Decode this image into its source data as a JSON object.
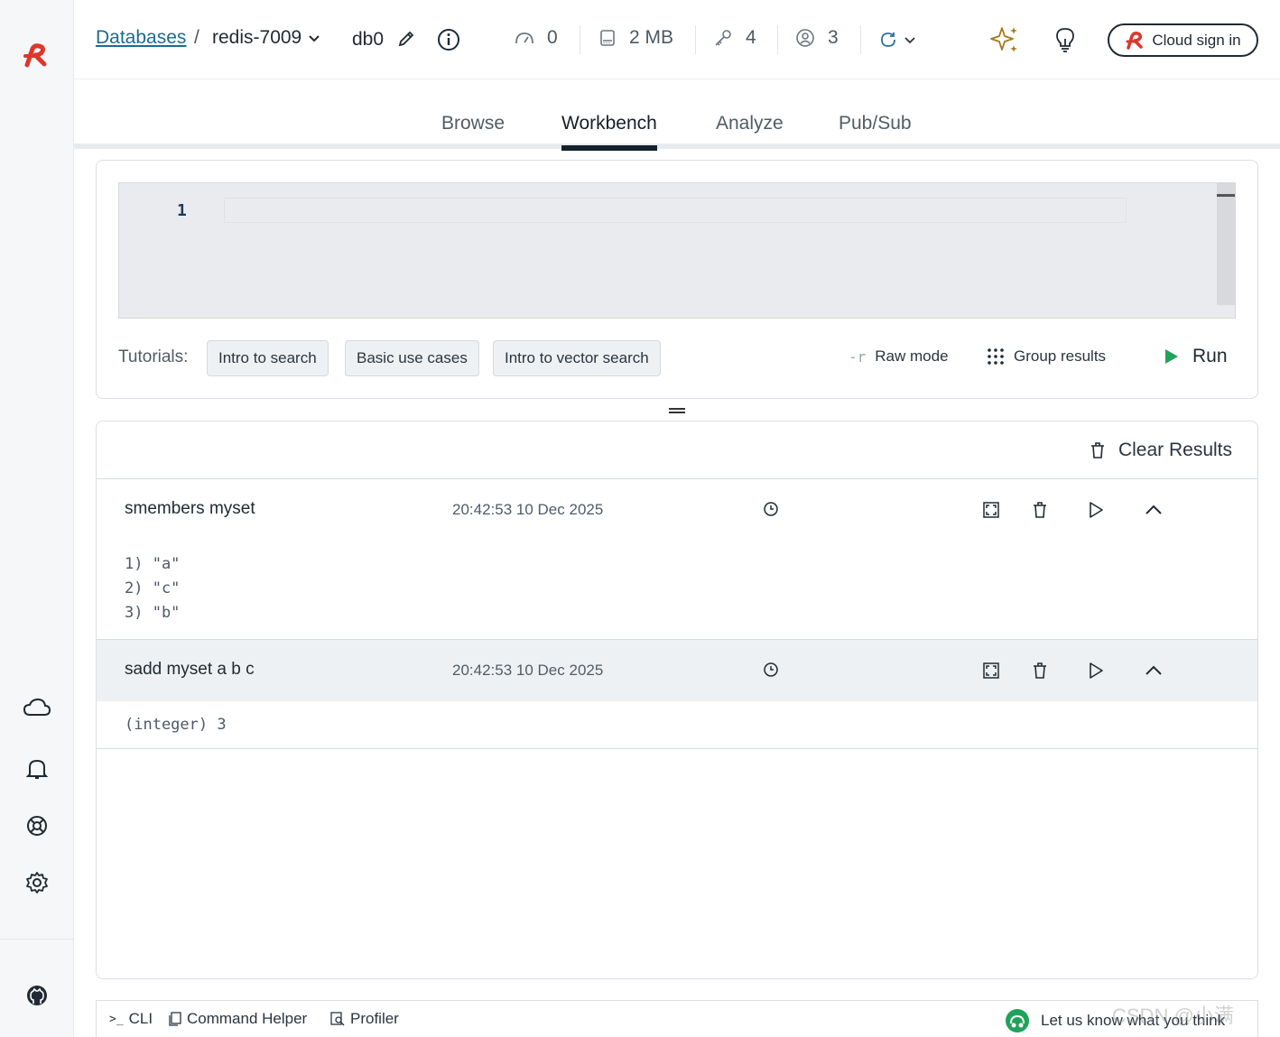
{
  "breadcrumb": {
    "link": "Databases",
    "separator": "/",
    "database": "redis-7009"
  },
  "db_index": "db0",
  "stats": {
    "commands_per_sec": "0",
    "memory": "2 MB",
    "keys": "4",
    "clients": "3"
  },
  "header": {
    "cloud_sign_in": "Cloud sign in"
  },
  "tabs": [
    {
      "label": "Browse"
    },
    {
      "label": "Workbench",
      "active": true
    },
    {
      "label": "Analyze"
    },
    {
      "label": "Pub/Sub"
    }
  ],
  "editor": {
    "line_number": "1",
    "value": ""
  },
  "tutorials": {
    "label": "Tutorials:",
    "items": [
      "Intro to search",
      "Basic use cases",
      "Intro to vector search"
    ]
  },
  "options": {
    "raw_mode": "Raw mode",
    "raw_mode_icon": "-r",
    "group_results": "Group results",
    "run": "Run"
  },
  "results": {
    "clear_label": "Clear Results",
    "items": [
      {
        "command": "smembers myset",
        "time": "20:42:53 10 Dec 2025",
        "output": [
          "1) \"a\"",
          "2) \"c\"",
          "3) \"b\""
        ]
      },
      {
        "command": "sadd myset a b c",
        "time": "20:42:53 10 Dec 2025",
        "output": [
          "(integer) 3"
        ]
      }
    ]
  },
  "bottombar": {
    "cli": "CLI",
    "command_helper": "Command Helper",
    "profiler": "Profiler",
    "feedback": "Let us know what you think"
  },
  "watermark": "CSDN @小满",
  "colors": {
    "brand_red": "#dc382c",
    "run_green": "#1fa35a",
    "link": "#1d6b8f",
    "sparkle": "#a57a1c"
  }
}
